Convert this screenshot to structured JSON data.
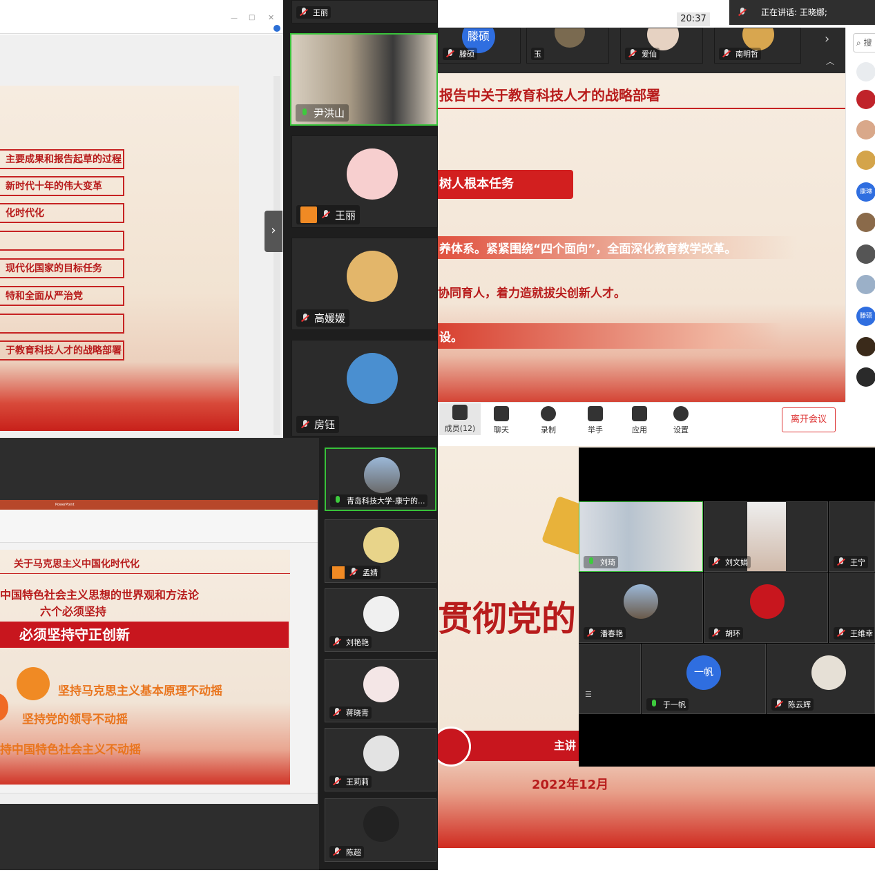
{
  "q1": {
    "slide_items": [
      "主要成果和报告起草的过程",
      "新时代十年的伟大变革",
      "化时代化",
      "",
      "现代化国家的目标任务",
      "特和全面从严治党",
      "",
      "于教育科技人才的战略部署"
    ],
    "participants": [
      {
        "name": "王丽",
        "top": true
      },
      {
        "name": "尹洪山"
      },
      {
        "name": "王丽"
      },
      {
        "name": "高媛媛"
      },
      {
        "name": "房钰"
      }
    ]
  },
  "q2": {
    "time": "20:37",
    "speaking": "正在讲话: 王晓娜;",
    "thumbs": [
      "滕硕",
      "玉",
      "爱仙",
      "南明哲"
    ],
    "slide_title": "报告中关于教育科技人才的战略部署",
    "slide_banner": "树人根本任务",
    "slide_lines": [
      "养体系。紧紧围绕“四个面向”，全面深化教育教学改革。",
      "协同育人，着力造就拔尖创新人才。",
      "设。"
    ],
    "toolbar": [
      "成员(12)",
      "聊天",
      "录制",
      "举手",
      "应用",
      "设置"
    ],
    "leave": "离开会议",
    "search_placeholder": "搜",
    "side_labels": [
      "康琳",
      "滕硕"
    ]
  },
  "q3": {
    "ppt_title": "PowerPoint",
    "slide_title": "关于马克思主义中国化时代化",
    "line1": "中国特色社会主义思想的世界观和方法论",
    "line2": "六个必须坚持",
    "banner": "必须坚持守正创新",
    "points": [
      "坚持马克思主义基本原理不动摇",
      "坚持党的领导不动摇",
      "持中国特色社会主义不动摇"
    ],
    "participants": [
      "青岛科技大学-康宁的...",
      "孟婧",
      "刘艳艳",
      "蒋晓青",
      "王莉莉",
      "陈超"
    ]
  },
  "q4": {
    "slide_big": "贯彻党的",
    "slide_sub": "主讲",
    "date": "2022年12月",
    "grid": [
      "刘琦",
      "刘文娟",
      "王宁",
      "潘春艳",
      "胡环",
      "王维幸",
      "于一帆",
      "陈云辉"
    ],
    "yifan_avatar": "一帆"
  },
  "colors": {
    "accent_red": "#c62222",
    "meeting_dark": "#2b2b2b"
  }
}
